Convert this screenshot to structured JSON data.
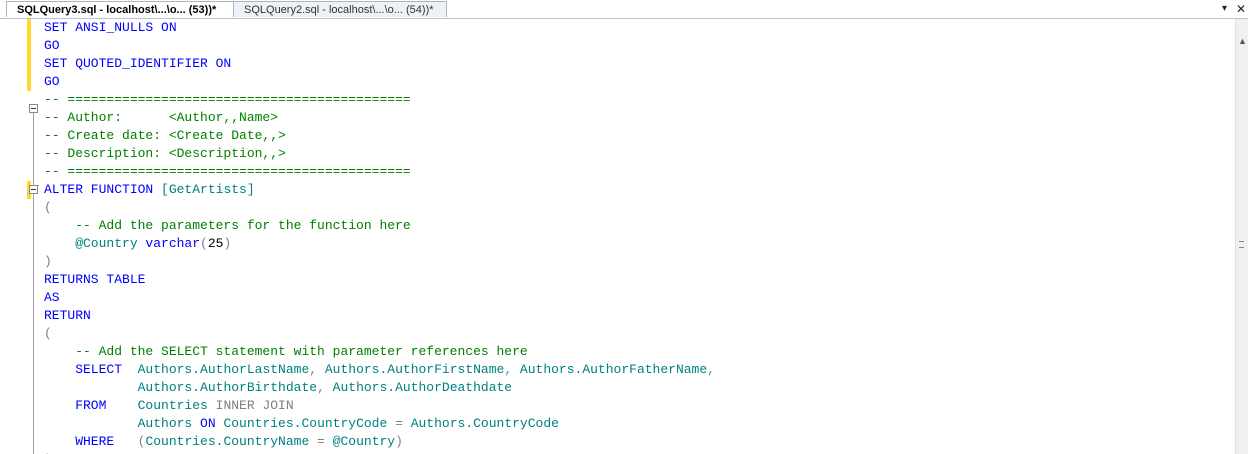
{
  "tabs": [
    {
      "label": "SQLQuery3.sql - localhost\\...\\o... (53))*",
      "active": true
    },
    {
      "label": "SQLQuery2.sql - localhost\\...\\o... (54))*",
      "active": false
    }
  ],
  "tabbar": {
    "dropdown_icon": "▾",
    "close_icon": "✕"
  },
  "colors": {
    "keyword": "#0000ff",
    "comment": "#008000",
    "identifier": "#008080",
    "operator": "#808080",
    "change_bar": "#ffd82a"
  },
  "code": {
    "l1_kw": "SET ANSI_NULLS ON",
    "l2_kw": "GO",
    "l3_kw": "SET QUOTED_IDENTIFIER ON",
    "l4_kw": "GO",
    "l5_cm": "-- ============================================",
    "l6_cm": "-- Author:      <Author,,Name>",
    "l7_cm": "-- Create date: <Create Date,,>",
    "l8_cm": "-- Description: <Description,,>",
    "l9_cm": "-- ============================================",
    "l10_kw": "ALTER FUNCTION ",
    "l10_fn": "[GetArtists]",
    "l11_gy": "(",
    "l12_cm": "    -- Add the parameters for the function here",
    "l13_pm": "    @Country ",
    "l13_kw": "varchar",
    "l13_gy": "(",
    "l13_tx": "25",
    "l13_gy2": ")",
    "l14_gy": ")",
    "l15_kw": "RETURNS TABLE",
    "l16_kw": "AS",
    "l17_kw": "RETURN",
    "l18_gy": "(",
    "l19_cm": "    -- Add the SELECT statement with parameter references here",
    "l20_kw": "    SELECT  ",
    "l20_fn": "Authors.AuthorLastName",
    "l20_gy": ", ",
    "l20_fn2": "Authors.AuthorFirstName",
    "l20_gy2": ", ",
    "l20_fn3": "Authors.AuthorFatherName",
    "l20_gy3": ",",
    "l21_sp": "            ",
    "l21_fn": "Authors.AuthorBirthdate",
    "l21_gy": ", ",
    "l21_fn2": "Authors.AuthorDeathdate",
    "l22_kw": "    FROM    ",
    "l22_fn": "Countries ",
    "l22_gy": "INNER JOIN",
    "l23_sp": "            ",
    "l23_fn": "Authors ",
    "l23_kw": "ON ",
    "l23_fn2": "Countries.CountryCode ",
    "l23_gy": "= ",
    "l23_fn3": "Authors.CountryCode",
    "l24_kw": "    WHERE   ",
    "l24_gy": "(",
    "l24_fn": "Countries.CountryName ",
    "l24_gy2": "= ",
    "l24_pm": "@Country",
    "l24_gy3": ")",
    "l25_gy": ")"
  }
}
